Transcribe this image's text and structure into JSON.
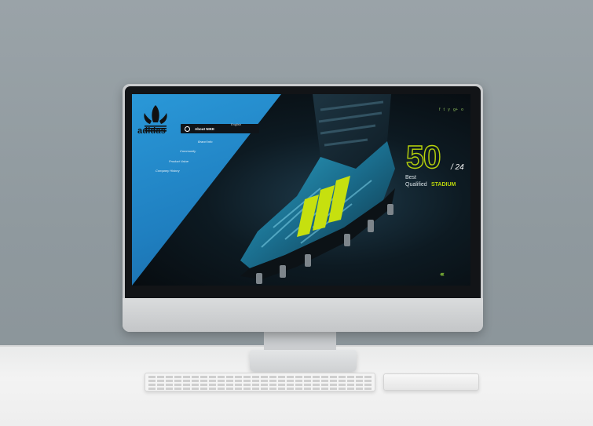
{
  "brand": {
    "logo_text": "adidas"
  },
  "menu": {
    "active_label": "About NIKE",
    "language": "English"
  },
  "nav": {
    "items": [
      {
        "label": "Brand Info"
      },
      {
        "label": "Community"
      },
      {
        "label": "Product Value"
      },
      {
        "label": "Company History"
      }
    ]
  },
  "social": {
    "icons": [
      "f",
      "t",
      "y",
      "g+",
      "o"
    ]
  },
  "hero": {
    "number": "50",
    "total": "/ 24",
    "line1": "Best",
    "line2": "Qualified",
    "highlight": "STADIUM"
  },
  "colors": {
    "accent": "#b9d40b",
    "blue": "#2a98d8"
  }
}
